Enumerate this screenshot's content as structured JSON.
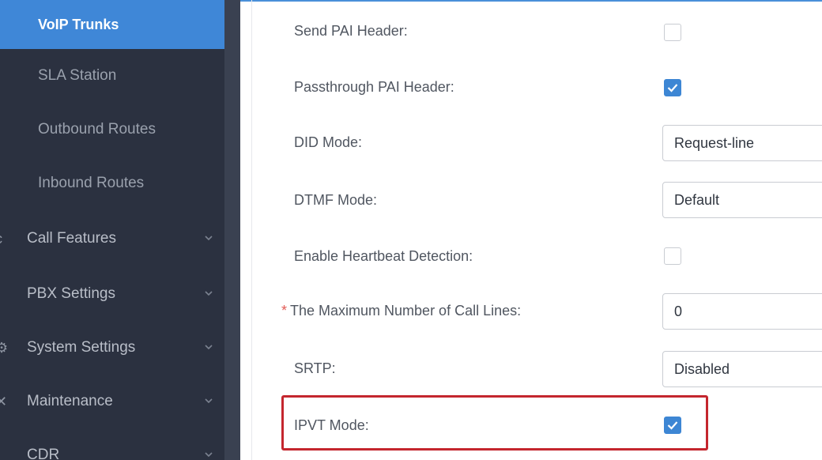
{
  "sidebar": {
    "items": [
      {
        "label": "VoIP Trunks",
        "active": true
      },
      {
        "label": "SLA Station"
      },
      {
        "label": "Outbound Routes"
      },
      {
        "label": "Inbound Routes"
      },
      {
        "label": "Call Features",
        "expandable": true
      },
      {
        "label": "PBX Settings",
        "expandable": true
      },
      {
        "label": "System Settings",
        "expandable": true
      },
      {
        "label": "Maintenance",
        "expandable": true
      },
      {
        "label": "CDR",
        "expandable": true
      }
    ]
  },
  "form": {
    "send_pai_header": {
      "label": "Send PAI Header:",
      "checked": false
    },
    "passthrough_pai_header": {
      "label": "Passthrough PAI Header:",
      "checked": true
    },
    "did_mode": {
      "label": "DID Mode:",
      "value": "Request-line"
    },
    "dtmf_mode": {
      "label": "DTMF Mode:",
      "value": "Default"
    },
    "enable_heartbeat_detection": {
      "label": "Enable Heartbeat Detection:",
      "checked": false
    },
    "max_call_lines": {
      "required_mark": "*",
      "label": "The Maximum Number of Call Lines:",
      "value": "0"
    },
    "srtp": {
      "label": "SRTP:",
      "value": "Disabled"
    },
    "ipvt_mode": {
      "label": "IPVT Mode:",
      "checked": true,
      "highlighted": true
    }
  },
  "colors": {
    "sidebar_bg": "#2b3140",
    "active_item": "#3f87d7",
    "checkbox_checked": "#3d86d4",
    "highlight_border": "#c4262e",
    "required_mark": "#e25b55"
  }
}
